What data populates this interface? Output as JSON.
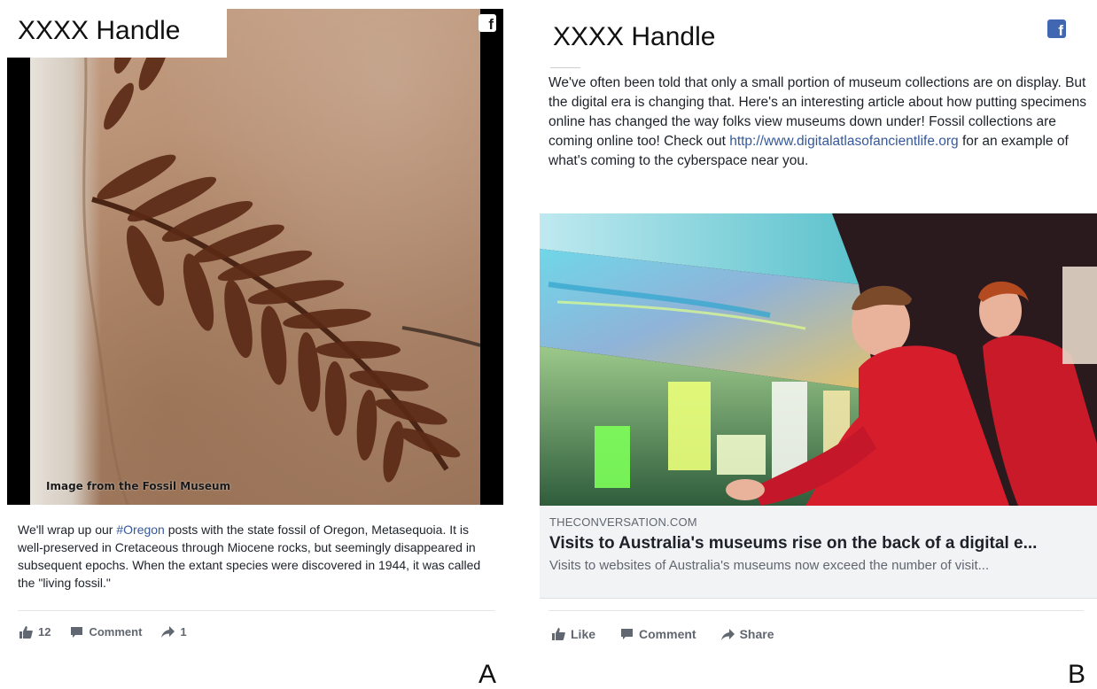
{
  "post_a": {
    "handle": "XXXX Handle",
    "platform_icon": "facebook-icon",
    "image_credit": "Image from the Fossil Museum",
    "text_before": "We'll wrap up our ",
    "hashtag": "#Oregon",
    "text_after": " posts with the state fossil of Oregon, Metasequoia. It is well-preserved in Cretaceous through Miocene rocks, but seemingly disappeared in subsequent epochs. When the extant species were discovered in 1944, it was called the \"living fossil.\"",
    "actions": {
      "likes_count": "12",
      "comment_label": "Comment",
      "shares_count": "1"
    },
    "panel_label": "A"
  },
  "post_b": {
    "handle": "XXXX Handle",
    "platform_icon": "facebook-icon",
    "text_before": "We've often been told that only a small portion of museum collections are on display. But the digital era is changing that. Here's an interesting article about how putting specimens online has changed the way folks view museums down under! Fossil collections are coming online too! Check out ",
    "link": "http://www.digitalatlasofancientlife.org",
    "text_after": " for an example of what's coming to the cyberspace near you.",
    "link_card": {
      "domain": "THECONVERSATION.COM",
      "title": "Visits to Australia's museums rise on the back of a digital e...",
      "description": "Visits to websites of Australia's museums now exceed the number of visit..."
    },
    "actions": {
      "like_label": "Like",
      "comment_label": "Comment",
      "share_label": "Share"
    },
    "panel_label": "B"
  },
  "colors": {
    "link_blue": "#365899",
    "facebook_blue": "#4267b2",
    "action_grey": "#616770",
    "card_bg": "#f2f3f5"
  }
}
